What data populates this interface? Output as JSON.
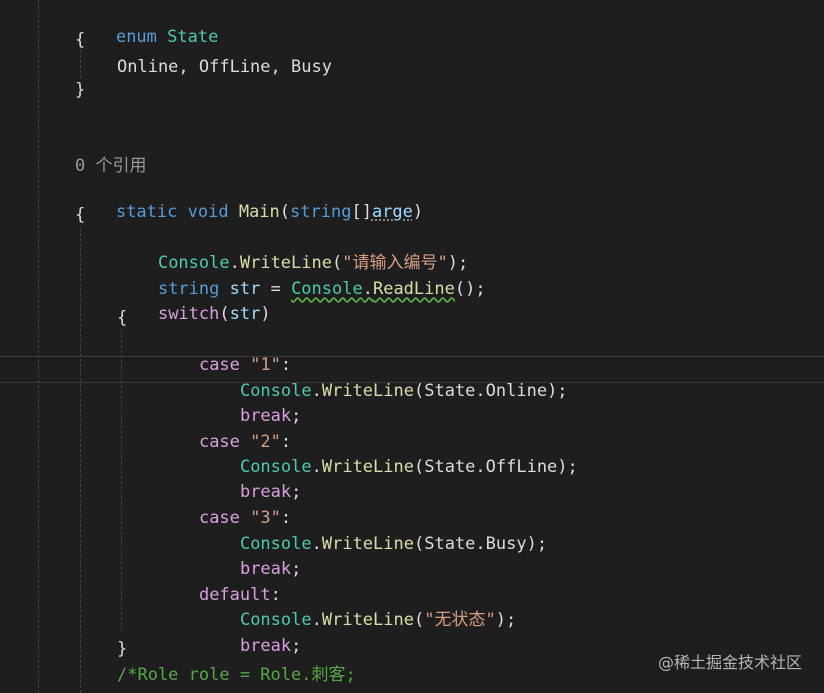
{
  "code": {
    "enum_decl": {
      "kw": "enum",
      "name": "State"
    },
    "brace_open": "{",
    "brace_close": "}",
    "enum_members": "Online, OffLine, Busy",
    "codelens": "0 个引用",
    "main_sig": {
      "static": "static",
      "void": "void",
      "name": "Main",
      "paren_open": "(",
      "param_type": "string",
      "brackets": "[]",
      "param_name": "arge",
      "paren_close": ")"
    },
    "l_writeline_prompt": {
      "cls": "Console",
      "dot": ".",
      "mth": "WriteLine",
      "open": "(",
      "str": "\"请输入编号\"",
      "close": ");"
    },
    "l_readline": {
      "type": "string",
      "var": "str",
      "eq": " = ",
      "cls": "Console",
      "dot": ".",
      "mth": "ReadLine",
      "rest": "();"
    },
    "l_switch": {
      "kw": "switch",
      "open": "(",
      "var": "str",
      "close": ")"
    },
    "cases": [
      {
        "kw": "case",
        "label": "\"1\"",
        "colon": ":",
        "arg": "State.Online"
      },
      {
        "kw": "case",
        "label": "\"2\"",
        "colon": ":",
        "arg": "State.OffLine"
      },
      {
        "kw": "case",
        "label": "\"3\"",
        "colon": ":",
        "arg": "State.Busy"
      }
    ],
    "default_kw": "default",
    "default_colon": ":",
    "default_str": "\"无状态\"",
    "break_kw": "break",
    "semicolon": ";",
    "close_paren_semi": ");",
    "console": "Console",
    "dot": ".",
    "writeline": "WriteLine",
    "paren_open": "(",
    "comment": "/*Role role = Role.刺客;"
  },
  "watermark": "@稀土掘金技术社区",
  "colors": {
    "background": "#1e1e1e",
    "keyword": "#569cd6",
    "type": "#4ec9b0",
    "control": "#d8a0df",
    "method": "#dcdcaa",
    "string": "#d69d85",
    "comment": "#57a64a"
  }
}
